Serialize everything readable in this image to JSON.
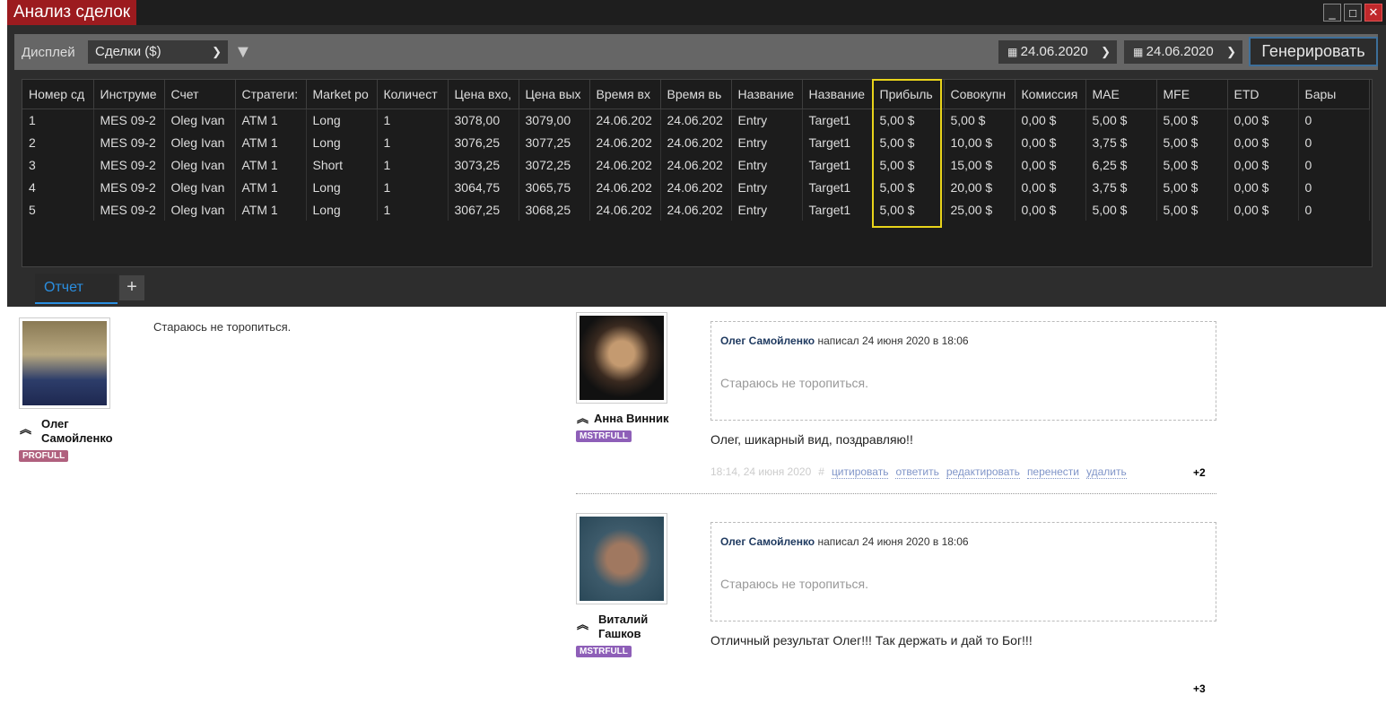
{
  "window": {
    "title": "Анализ сделок",
    "minimize": "_",
    "maximize": "□",
    "close": "✕"
  },
  "toolbar": {
    "display_label": "Дисплей",
    "display_value": "Сделки ($)",
    "date_from": "24.06.2020",
    "date_to": "24.06.2020",
    "generate": "Генерировать"
  },
  "table": {
    "columns": [
      "Номер сд",
      "Инструме",
      "Счет",
      "Стратеги:",
      "Market po",
      "Количест",
      "Цена вхо,",
      "Цена вых",
      "Время вх",
      "Время вь",
      "Название",
      "Название",
      "Прибыль",
      "Совокупн",
      "Комиссия",
      "MAE",
      "MFE",
      "ETD",
      "Бары"
    ],
    "rows": [
      [
        "1",
        "MES 09-2",
        "Oleg Ivan",
        "ATM 1",
        "Long",
        "1",
        "3078,00",
        "3079,00",
        "24.06.202",
        "24.06.202",
        "Entry",
        "Target1",
        "5,00 $",
        "5,00 $",
        "0,00 $",
        "5,00 $",
        "5,00 $",
        "0,00 $",
        "0"
      ],
      [
        "2",
        "MES 09-2",
        "Oleg Ivan",
        "ATM 1",
        "Long",
        "1",
        "3076,25",
        "3077,25",
        "24.06.202",
        "24.06.202",
        "Entry",
        "Target1",
        "5,00 $",
        "10,00 $",
        "0,00 $",
        "3,75 $",
        "5,00 $",
        "0,00 $",
        "0"
      ],
      [
        "3",
        "MES 09-2",
        "Oleg Ivan",
        "ATM 1",
        "Short",
        "1",
        "3073,25",
        "3072,25",
        "24.06.202",
        "24.06.202",
        "Entry",
        "Target1",
        "5,00 $",
        "15,00 $",
        "0,00 $",
        "6,25 $",
        "5,00 $",
        "0,00 $",
        "0"
      ],
      [
        "4",
        "MES 09-2",
        "Oleg Ivan",
        "ATM 1",
        "Long",
        "1",
        "3064,75",
        "3065,75",
        "24.06.202",
        "24.06.202",
        "Entry",
        "Target1",
        "5,00 $",
        "20,00 $",
        "0,00 $",
        "3,75 $",
        "5,00 $",
        "0,00 $",
        "0"
      ],
      [
        "5",
        "MES 09-2",
        "Oleg Ivan",
        "ATM 1",
        "Long",
        "1",
        "3067,25",
        "3068,25",
        "24.06.202",
        "24.06.202",
        "Entry",
        "Target1",
        "5,00 $",
        "25,00 $",
        "0,00 $",
        "5,00 $",
        "5,00 $",
        "0,00 $",
        "0"
      ]
    ]
  },
  "tabs": {
    "report": "Отчет",
    "add": "+"
  },
  "post": {
    "author": "Олег Самойленко",
    "badge": "PROFULL",
    "text": "Стараюсь не торопиться."
  },
  "comments": [
    {
      "author": "Анна Винник",
      "badge": "MSTRFULL",
      "quote_author": "Олег Самойленко",
      "quote_meta": "написал 24 июня 2020 в 18:06",
      "quote_text": "Стараюсь не торопиться.",
      "text": "Олег, шикарный вид, поздравляю!!",
      "time": "18:14, 24 июня 2020",
      "hash": "#",
      "actions": [
        "цитировать",
        "ответить",
        "редактировать",
        "перенести",
        "удалить"
      ],
      "score": "+2"
    },
    {
      "author": "Виталий Гашков",
      "badge": "MSTRFULL",
      "quote_author": "Олег Самойленко",
      "quote_meta": "написал 24 июня 2020 в 18:06",
      "quote_text": "Стараюсь не торопиться.",
      "text": "Отличный результат Олег!!! Так держать и дай то Бог!!!",
      "score": "+3"
    }
  ],
  "colors": {
    "accent": "#9c1b1f",
    "highlight": "#e8d31a",
    "tab": "#2a8ee0",
    "profull": "#b0607e",
    "mstrfull": "#8e5fb8"
  }
}
